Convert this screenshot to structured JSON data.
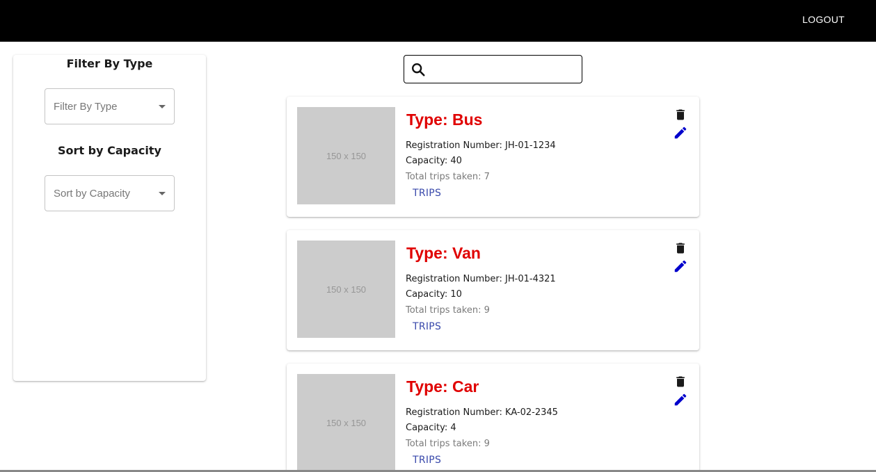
{
  "header": {
    "logout_label": "LOGOUT"
  },
  "sidebar": {
    "filter_heading": "Filter By Type",
    "filter_placeholder": "Filter By Type",
    "sort_heading": "Sort by Capacity",
    "sort_placeholder": "Sort by Capacity"
  },
  "search": {
    "value": "",
    "icon": "search-icon"
  },
  "vehicles": [
    {
      "image_label": "150 x 150",
      "type": "Type: Bus",
      "registration": "Registration Number: JH-01-1234",
      "capacity": "Capacity: 40",
      "trips_taken": "Total trips taken: 7",
      "trips_button": "TRIPS"
    },
    {
      "image_label": "150 x 150",
      "type": "Type: Van",
      "registration": "Registration Number: JH-01-4321",
      "capacity": "Capacity: 10",
      "trips_taken": "Total trips taken: 9",
      "trips_button": "TRIPS"
    },
    {
      "image_label": "150 x 150",
      "type": "Type: Car",
      "registration": "Registration Number: KA-02-2345",
      "capacity": "Capacity: 4",
      "trips_taken": "Total trips taken: 9",
      "trips_button": "TRIPS"
    }
  ],
  "colors": {
    "topbar": "#000000",
    "type_title": "#e00000",
    "edit_icon": "#0000cc",
    "trash_icon": "#1a1a1a",
    "trips_button": "#3949ab"
  }
}
